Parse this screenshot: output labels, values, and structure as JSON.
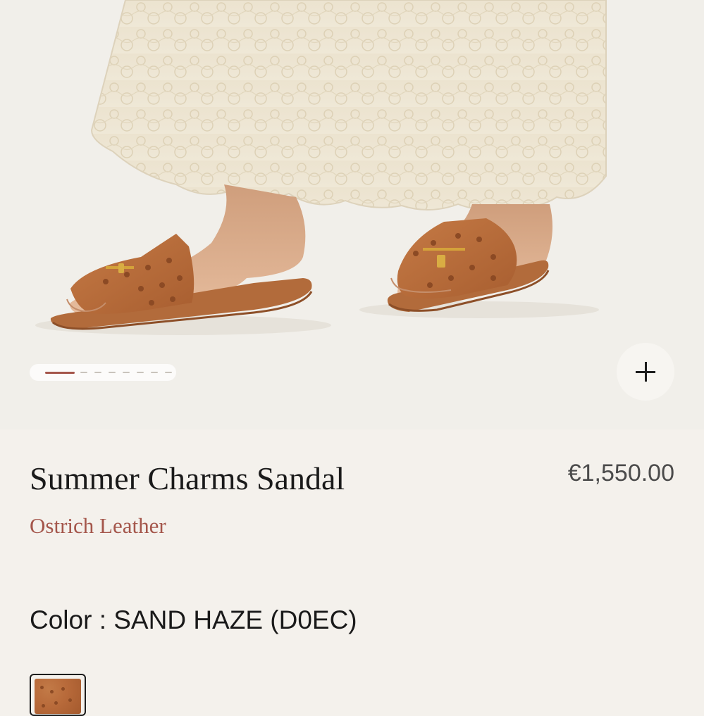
{
  "hero": {
    "image": "sandal-product-photo",
    "carousel": {
      "total_slides": 8,
      "active_index": 0
    },
    "zoom_icon": "plus-icon"
  },
  "product": {
    "title": "Summer Charms Sandal",
    "material": "Ostrich Leather",
    "price": "€1,550.00"
  },
  "color": {
    "label": "Color : SAND HAZE (D0EC)"
  },
  "colors": {
    "accent": "#a4564b",
    "background": "#f4f1ec",
    "leather": "#b86a3a"
  }
}
